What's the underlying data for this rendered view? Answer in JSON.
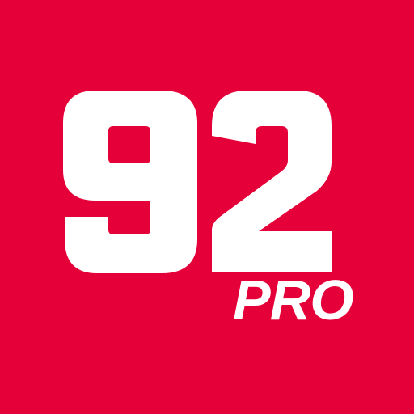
{
  "app_icon": {
    "number": "92",
    "badge": "PRO",
    "colors": {
      "background": "#E60039",
      "foreground": "#FFFFFF"
    }
  }
}
